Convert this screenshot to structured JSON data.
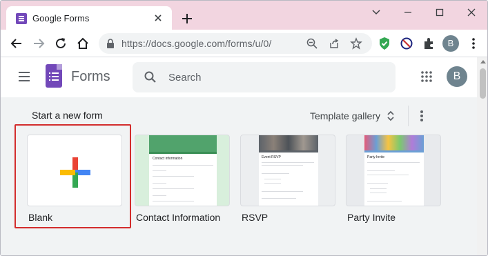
{
  "browser": {
    "tab_title": "Google Forms",
    "url": "https://docs.google.com/forms/u/0/",
    "profile_initial": "B"
  },
  "header": {
    "app_name": "Forms",
    "search_placeholder": "Search",
    "profile_initial": "B"
  },
  "new_form": {
    "title": "Start a new form",
    "gallery_label": "Template gallery",
    "templates": [
      {
        "label": "Blank",
        "selected": true
      },
      {
        "label": "Contact Information",
        "form_heading": "Contact information"
      },
      {
        "label": "RSVP",
        "form_heading": "Event RSVP"
      },
      {
        "label": "Party Invite",
        "form_heading": "Party Invite"
      }
    ]
  },
  "colors": {
    "tab_strip": "#f2d5e0",
    "forms_purple": "#7248b9",
    "highlight_red": "#d32c2c",
    "contact_green": "#51a36c",
    "rsvp_gray": "#5c6269",
    "party_blue": "#6b9fd5"
  }
}
